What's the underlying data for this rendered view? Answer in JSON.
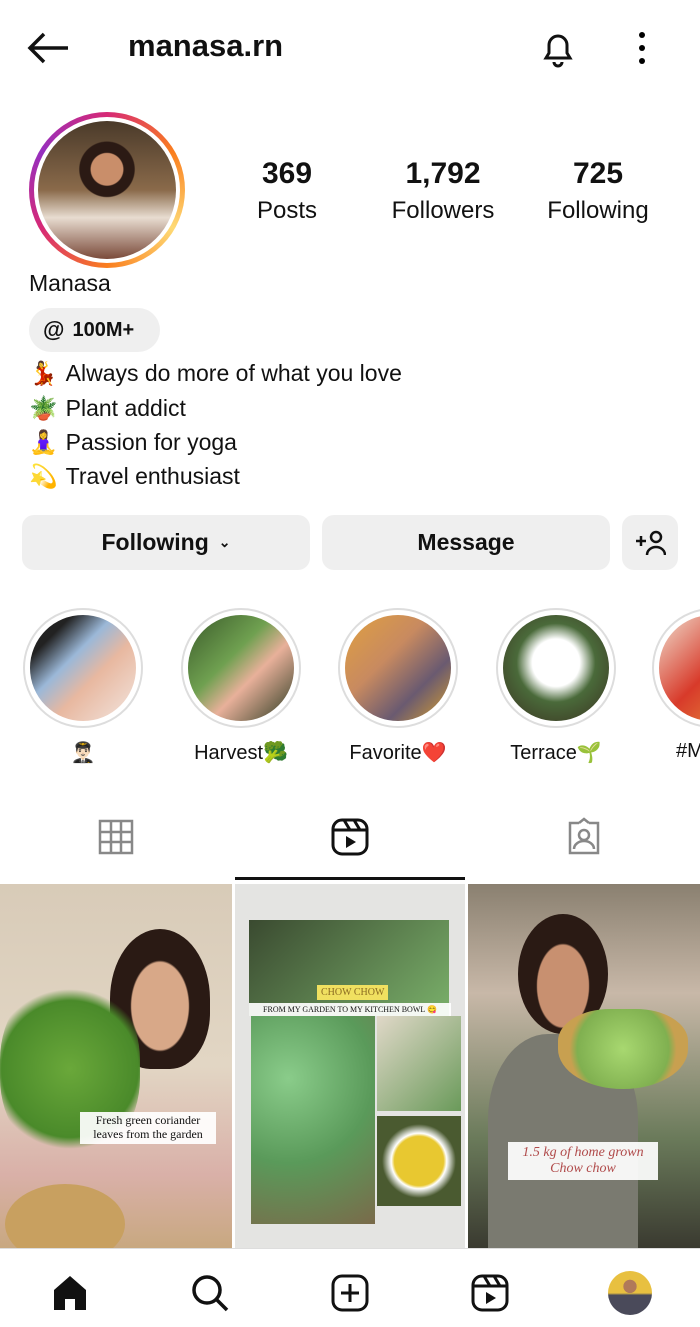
{
  "header": {
    "username": "manasa.rn",
    "back_icon": "arrow-left-icon",
    "bell_icon": "bell-icon",
    "more_icon": "more-vertical-icon"
  },
  "profile": {
    "name": "Manasa",
    "stats": [
      {
        "value": "369",
        "label": "Posts"
      },
      {
        "value": "1,792",
        "label": "Followers"
      },
      {
        "value": "725",
        "label": "Following"
      }
    ],
    "threads_badge": "100M+",
    "bio": [
      {
        "emoji": "💃",
        "text": "Always do more of what you love"
      },
      {
        "emoji": "🪴",
        "text": "Plant addict"
      },
      {
        "emoji": "🧘‍♀️",
        "text": "Passion for yoga"
      },
      {
        "emoji": "💫",
        "text": "Travel enthusiast"
      }
    ]
  },
  "actions": {
    "following": "Following",
    "message": "Message"
  },
  "highlights": [
    {
      "label": "👨🏻‍✈️"
    },
    {
      "label": "Harvest🥦"
    },
    {
      "label": "Favorite❤️"
    },
    {
      "label": "Terrace🌱"
    },
    {
      "label": "#M"
    }
  ],
  "tabs": {
    "active": "reels"
  },
  "posts": [
    {
      "caption": "Fresh green coriander leaves from the garden"
    },
    {
      "title": "CHOW CHOW",
      "caption": "FROM MY GARDEN TO MY KITCHEN BOWL 😋"
    },
    {
      "caption": "1.5 kg of home grown Chow chow"
    }
  ],
  "colors": {
    "accent": "#111111",
    "button_bg": "#efefef"
  }
}
